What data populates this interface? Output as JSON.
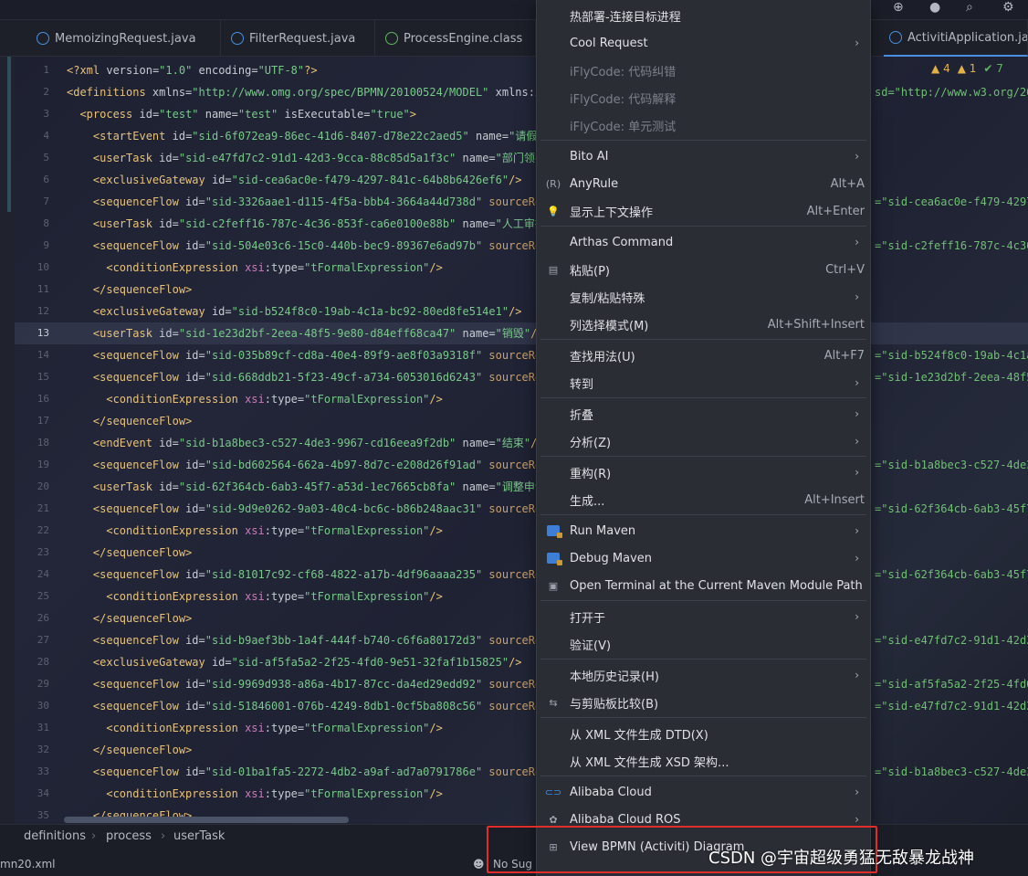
{
  "tabs": [
    {
      "label": "MemoizingRequest.java",
      "icon": "class-icon"
    },
    {
      "label": "FilterRequest.java",
      "icon": "class-icon"
    },
    {
      "label": "ProcessEngine.class",
      "icon": "interface-icon"
    },
    {
      "label": "ActivitiApplication.java",
      "icon": "class-icon"
    }
  ],
  "inspections": {
    "warnings": "4",
    "weak_warnings": "1",
    "ok": "7"
  },
  "code_lines": [
    {
      "n": "1",
      "html": "<span class='tag'>&lt;?xml </span><span class='an'>version</span>=<span class='av'>\"1.0\"</span> <span class='an'>encoding</span>=<span class='av'>\"UTF-8\"</span><span class='tag'>?&gt;</span>",
      "right": ""
    },
    {
      "n": "2",
      "html": "<span class='tag'>&lt;definitions </span><span class='an'>xmlns</span>=<span class='av'>\"http://www.omg.org/spec/BPMN/20100524/MODEL\"</span> <span class='an'>xmlns</span>:<span class='ns'>xsi</span>",
      "right": "sd=\"http://www.w3.org/200"
    },
    {
      "n": "3",
      "html": "  <span class='tag'>&lt;process </span><span class='an'>id</span>=<span class='av'>\"test\"</span> <span class='an'>name</span>=<span class='av'>\"test\"</span> <span class='an'>isExecutable</span>=<span class='av'>\"true\"</span><span class='tag'>&gt;</span>",
      "right": ""
    },
    {
      "n": "4",
      "html": "    <span class='tag'>&lt;startEvent </span><span class='an'>id</span>=<span class='av'>\"sid-6f072ea9-86ec-41d6-8407-d78e22c2aed5\"</span> <span class='an'>name</span>=<span class='av'>\"请假提</span>",
      "right": ""
    },
    {
      "n": "5",
      "html": "    <span class='tag'>&lt;userTask </span><span class='an'>id</span>=<span class='av'>\"sid-e47fd7c2-91d1-42d3-9cca-88c85d5a1f3c\"</span> <span class='an'>name</span>=<span class='av'>\"部门领导</span>",
      "right": ""
    },
    {
      "n": "6",
      "html": "    <span class='tag'>&lt;exclusiveGateway </span><span class='an'>id</span>=<span class='av'>\"sid-cea6ac0e-f479-4297-841c-64b8b6426ef6\"</span><span class='tag'>/&gt;</span>",
      "right": ""
    },
    {
      "n": "7",
      "html": "    <span class='tag'>&lt;sequenceFlow </span><span class='an'>id</span>=<span class='av'>\"sid-3326aae1-d115-4f5a-bbb4-3664a44d738d\"</span> <span class='pr'>sourceRef</span>",
      "right": "=\"sid-cea6ac0e-f479-4297-"
    },
    {
      "n": "8",
      "html": "    <span class='tag'>&lt;userTask </span><span class='an'>id</span>=<span class='av'>\"sid-c2feff16-787c-4c36-853f-ca6e0100e88b\"</span> <span class='an'>name</span>=<span class='av'>\"人工审批\"</span>",
      "right": ""
    },
    {
      "n": "9",
      "html": "    <span class='tag'>&lt;sequenceFlow </span><span class='an'>id</span>=<span class='av'>\"sid-504e03c6-15c0-440b-bec9-89367e6ad97b\"</span> <span class='pr'>sourceRef</span>",
      "right": "=\"sid-c2feff16-787c-4c36-"
    },
    {
      "n": "10",
      "html": "      <span class='tag'>&lt;conditionExpression </span><span class='ns'>xsi</span>:<span class='an'>type</span>=<span class='av'>\"tFormalExpression\"</span><span class='tag'>/&gt;</span>",
      "right": ""
    },
    {
      "n": "11",
      "html": "    <span class='tag'>&lt;/sequenceFlow&gt;</span>",
      "right": ""
    },
    {
      "n": "12",
      "html": "    <span class='tag'>&lt;exclusiveGateway </span><span class='an'>id</span>=<span class='av'>\"sid-b524f8c0-19ab-4c1a-bc92-80ed8fe514e1\"</span><span class='tag'>/&gt;</span>",
      "right": ""
    },
    {
      "n": "13",
      "html": "    <span class='tag'>&lt;userTask </span><span class='an'>id</span>=<span class='av'>\"sid-1e23d2bf-2eea-48f5-9e80-d84eff68ca47\"</span> <span class='an'>name</span>=<span class='av'>\"销毁\"</span><span class='tag'>/&gt;</span>",
      "right": ""
    },
    {
      "n": "14",
      "html": "    <span class='tag'>&lt;sequenceFlow </span><span class='an'>id</span>=<span class='av'>\"sid-035b89cf-cd8a-40e4-89f9-ae8f03a9318f\"</span> <span class='pr'>sourceRef</span>",
      "right": "=\"sid-b524f8c0-19ab-4c1a-"
    },
    {
      "n": "15",
      "html": "    <span class='tag'>&lt;sequenceFlow </span><span class='an'>id</span>=<span class='av'>\"sid-668ddb21-5f23-49cf-a734-6053016d6243\"</span> <span class='pr'>sourceRef</span>",
      "right": "=\"sid-1e23d2bf-2eea-48f5-"
    },
    {
      "n": "16",
      "html": "      <span class='tag'>&lt;conditionExpression </span><span class='ns'>xsi</span>:<span class='an'>type</span>=<span class='av'>\"tFormalExpression\"</span><span class='tag'>/&gt;</span>",
      "right": ""
    },
    {
      "n": "17",
      "html": "    <span class='tag'>&lt;/sequenceFlow&gt;</span>",
      "right": ""
    },
    {
      "n": "18",
      "html": "    <span class='tag'>&lt;endEvent </span><span class='an'>id</span>=<span class='av'>\"sid-b1a8bec3-c527-4de3-9967-cd16eea9f2db\"</span> <span class='an'>name</span>=<span class='av'>\"结束\"</span><span class='tag'>/&gt;</span>",
      "right": ""
    },
    {
      "n": "19",
      "html": "    <span class='tag'>&lt;sequenceFlow </span><span class='an'>id</span>=<span class='av'>\"sid-bd602564-662a-4b97-8d7c-e208d26f91ad\"</span> <span class='pr'>sourceRef</span>",
      "right": "=\"sid-b1a8bec3-c527-4de3-"
    },
    {
      "n": "20",
      "html": "    <span class='tag'>&lt;userTask </span><span class='an'>id</span>=<span class='av'>\"sid-62f364cb-6ab3-45f7-a53d-1ec7665cb8fa\"</span> <span class='an'>name</span>=<span class='av'>\"调整申请\"</span>",
      "right": ""
    },
    {
      "n": "21",
      "html": "    <span class='tag'>&lt;sequenceFlow </span><span class='an'>id</span>=<span class='av'>\"sid-9d9e0262-9a03-40c4-bc6c-b86b248aac31\"</span> <span class='pr'>sourceRef</span>",
      "right": "=\"sid-62f364cb-6ab3-45f7-"
    },
    {
      "n": "22",
      "html": "      <span class='tag'>&lt;conditionExpression </span><span class='ns'>xsi</span>:<span class='an'>type</span>=<span class='av'>\"tFormalExpression\"</span><span class='tag'>/&gt;</span>",
      "right": ""
    },
    {
      "n": "23",
      "html": "    <span class='tag'>&lt;/sequenceFlow&gt;</span>",
      "right": ""
    },
    {
      "n": "24",
      "html": "    <span class='tag'>&lt;sequenceFlow </span><span class='an'>id</span>=<span class='av'>\"sid-81017c92-cf68-4822-a17b-4df96aaaa235\"</span> <span class='pr'>sourceRef</span>",
      "right": "=\"sid-62f364cb-6ab3-45f7-"
    },
    {
      "n": "25",
      "html": "      <span class='tag'>&lt;conditionExpression </span><span class='ns'>xsi</span>:<span class='an'>type</span>=<span class='av'>\"tFormalExpression\"</span><span class='tag'>/&gt;</span>",
      "right": ""
    },
    {
      "n": "26",
      "html": "    <span class='tag'>&lt;/sequenceFlow&gt;</span>",
      "right": ""
    },
    {
      "n": "27",
      "html": "    <span class='tag'>&lt;sequenceFlow </span><span class='an'>id</span>=<span class='av'>\"sid-b9aef3bb-1a4f-444f-b740-c6f6a80172d3\"</span> <span class='pr'>sourceRef</span>",
      "right": "=\"sid-e47fd7c2-91d1-42d3-"
    },
    {
      "n": "28",
      "html": "    <span class='tag'>&lt;exclusiveGateway </span><span class='an'>id</span>=<span class='av'>\"sid-af5fa5a2-2f25-4fd0-9e51-32faf1b15825\"</span><span class='tag'>/&gt;</span>",
      "right": ""
    },
    {
      "n": "29",
      "html": "    <span class='tag'>&lt;sequenceFlow </span><span class='an'>id</span>=<span class='av'>\"sid-9969d938-a86a-4b17-87cc-da4ed29edd92\"</span> <span class='pr'>sourceRef</span>",
      "right": "=\"sid-af5fa5a2-2f25-4fd0-"
    },
    {
      "n": "30",
      "html": "    <span class='tag'>&lt;sequenceFlow </span><span class='an'>id</span>=<span class='av'>\"sid-51846001-076b-4249-8db1-0cf5ba808c56\"</span> <span class='pr'>sourceRef</span>",
      "right": "=\"sid-e47fd7c2-91d1-42d3-"
    },
    {
      "n": "31",
      "html": "      <span class='tag'>&lt;conditionExpression </span><span class='ns'>xsi</span>:<span class='an'>type</span>=<span class='av'>\"tFormalExpression\"</span><span class='tag'>/&gt;</span>",
      "right": ""
    },
    {
      "n": "32",
      "html": "    <span class='tag'>&lt;/sequenceFlow&gt;</span>",
      "right": ""
    },
    {
      "n": "33",
      "html": "    <span class='tag'>&lt;sequenceFlow </span><span class='an'>id</span>=<span class='av'>\"sid-01ba1fa5-2272-4db2-a9af-ad7a0791786e\"</span> <span class='pr'>sourceRef</span>",
      "right": "=\"sid-b1a8bec3-c527-4de3-"
    },
    {
      "n": "34",
      "html": "      <span class='tag'>&lt;conditionExpression </span><span class='ns'>xsi</span>:<span class='an'>type</span>=<span class='av'>\"tFormalExpression\"</span><span class='tag'>/&gt;</span>",
      "right": ""
    },
    {
      "n": "35",
      "html": "    <span class='tag'>&lt;/sequenceFlow&gt;</span>",
      "right": ""
    }
  ],
  "current_line": "13",
  "breadcrumb": [
    "definitions",
    "process",
    "userTask"
  ],
  "status": {
    "file": "mn20.xml",
    "suggestion": "No Sug"
  },
  "menu": [
    {
      "type": "item",
      "label": "热部署-连接目标进程",
      "icon": "",
      "shortcut": "",
      "arrow": false,
      "disabled": false
    },
    {
      "type": "item",
      "label": "Cool Request",
      "icon": "",
      "shortcut": "",
      "arrow": true,
      "disabled": false
    },
    {
      "type": "item",
      "label": "iFlyCode: 代码纠错",
      "icon": "",
      "shortcut": "",
      "arrow": false,
      "disabled": true
    },
    {
      "type": "item",
      "label": "iFlyCode: 代码解释",
      "icon": "",
      "shortcut": "",
      "arrow": false,
      "disabled": true
    },
    {
      "type": "item",
      "label": "iFlyCode: 单元测试",
      "icon": "",
      "shortcut": "",
      "arrow": false,
      "disabled": true
    },
    {
      "type": "sep"
    },
    {
      "type": "item",
      "label": "Bito AI",
      "icon": "",
      "shortcut": "",
      "arrow": true,
      "disabled": false
    },
    {
      "type": "item",
      "label": "AnyRule",
      "icon": "regex-icon",
      "shortcut": "Alt+A",
      "arrow": false,
      "disabled": false
    },
    {
      "type": "item",
      "label": "显示上下文操作",
      "icon": "bulb-icon",
      "shortcut": "Alt+Enter",
      "arrow": false,
      "disabled": false
    },
    {
      "type": "sep"
    },
    {
      "type": "item",
      "label": "Arthas Command",
      "icon": "",
      "shortcut": "",
      "arrow": true,
      "disabled": false
    },
    {
      "type": "item",
      "label": "粘贴(P)",
      "icon": "clipboard-icon",
      "shortcut": "Ctrl+V",
      "arrow": false,
      "disabled": false
    },
    {
      "type": "item",
      "label": "复制/粘贴特殊",
      "icon": "",
      "shortcut": "",
      "arrow": true,
      "disabled": false
    },
    {
      "type": "item",
      "label": "列选择模式(M)",
      "icon": "",
      "shortcut": "Alt+Shift+Insert",
      "arrow": false,
      "disabled": false
    },
    {
      "type": "sep"
    },
    {
      "type": "item",
      "label": "查找用法(U)",
      "icon": "",
      "shortcut": "Alt+F7",
      "arrow": false,
      "disabled": false
    },
    {
      "type": "item",
      "label": "转到",
      "icon": "",
      "shortcut": "",
      "arrow": true,
      "disabled": false
    },
    {
      "type": "sep"
    },
    {
      "type": "item",
      "label": "折叠",
      "icon": "",
      "shortcut": "",
      "arrow": true,
      "disabled": false
    },
    {
      "type": "item",
      "label": "分析(Z)",
      "icon": "",
      "shortcut": "",
      "arrow": true,
      "disabled": false
    },
    {
      "type": "sep"
    },
    {
      "type": "item",
      "label": "重构(R)",
      "icon": "",
      "shortcut": "",
      "arrow": true,
      "disabled": false
    },
    {
      "type": "item",
      "label": "生成...",
      "icon": "",
      "shortcut": "Alt+Insert",
      "arrow": false,
      "disabled": false
    },
    {
      "type": "sep"
    },
    {
      "type": "item",
      "label": "Run Maven",
      "icon": "maven-icon",
      "shortcut": "",
      "arrow": true,
      "disabled": false
    },
    {
      "type": "item",
      "label": "Debug Maven",
      "icon": "maven-icon",
      "shortcut": "",
      "arrow": true,
      "disabled": false
    },
    {
      "type": "item",
      "label": "Open Terminal at the Current Maven Module Path",
      "icon": "terminal-icon",
      "shortcut": "",
      "arrow": false,
      "disabled": false
    },
    {
      "type": "sep"
    },
    {
      "type": "item",
      "label": "打开于",
      "icon": "",
      "shortcut": "",
      "arrow": true,
      "disabled": false
    },
    {
      "type": "item",
      "label": "验证(V)",
      "icon": "",
      "shortcut": "",
      "arrow": false,
      "disabled": false
    },
    {
      "type": "sep"
    },
    {
      "type": "item",
      "label": "本地历史记录(H)",
      "icon": "",
      "shortcut": "",
      "arrow": true,
      "disabled": false
    },
    {
      "type": "item",
      "label": "与剪贴板比较(B)",
      "icon": "compare-icon",
      "shortcut": "",
      "arrow": false,
      "disabled": false
    },
    {
      "type": "sep"
    },
    {
      "type": "item",
      "label": "从 XML 文件生成 DTD(X)",
      "icon": "",
      "shortcut": "",
      "arrow": false,
      "disabled": false
    },
    {
      "type": "item",
      "label": "从 XML 文件生成 XSD 架构...",
      "icon": "",
      "shortcut": "",
      "arrow": false,
      "disabled": false
    },
    {
      "type": "sep"
    },
    {
      "type": "item",
      "label": "Alibaba Cloud",
      "icon": "alibaba-cloud-icon",
      "shortcut": "",
      "arrow": true,
      "disabled": false
    },
    {
      "type": "item",
      "label": "Alibaba Cloud ROS",
      "icon": "alibaba-ros-icon",
      "shortcut": "",
      "arrow": true,
      "disabled": false
    },
    {
      "type": "item",
      "label": "View BPMN (Activiti) Diagram",
      "icon": "bpmn-diagram-icon",
      "shortcut": "",
      "arrow": false,
      "disabled": false
    }
  ],
  "watermark": "CSDN @宇宙超级勇猛无敌暴龙战神",
  "colors": {
    "highlight_border": "#e12c2c",
    "accent": "#4a8fe0"
  }
}
